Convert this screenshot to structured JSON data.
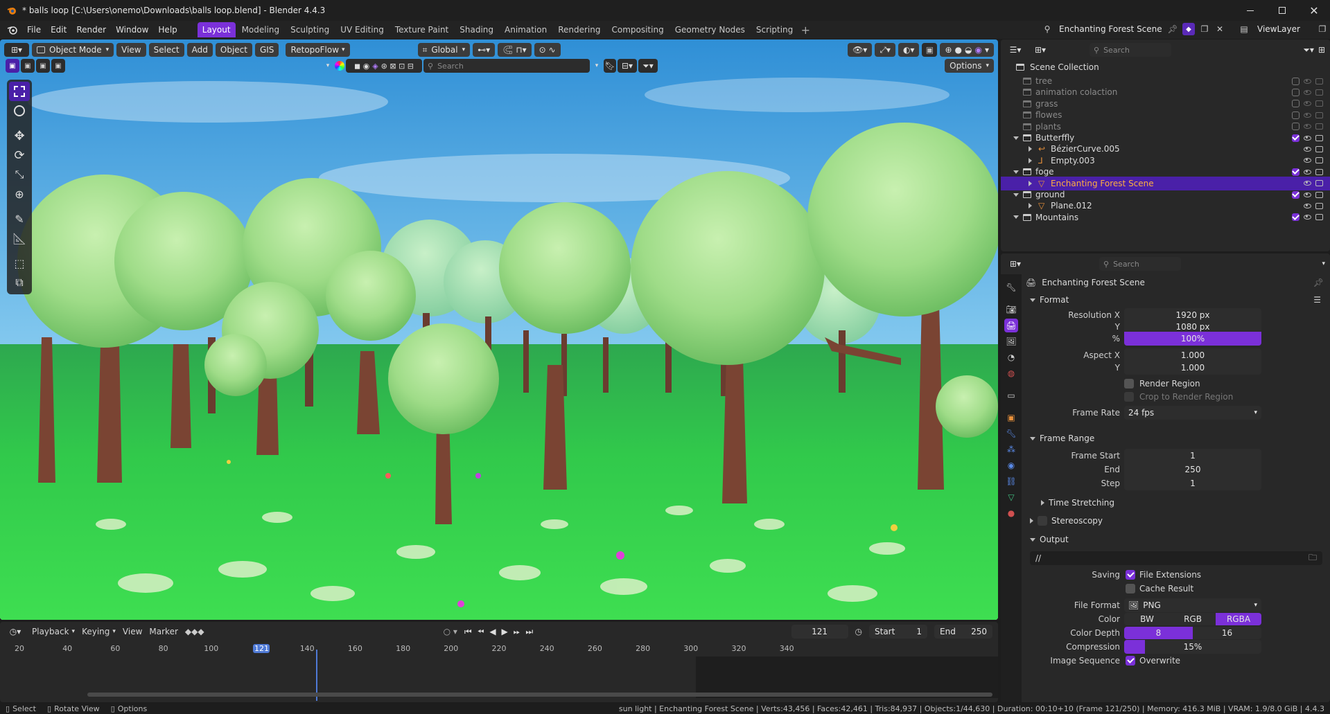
{
  "title_bar": {
    "title": "* balls loop [C:\\Users\\onemo\\Downloads\\balls loop.blend] - Blender 4.4.3"
  },
  "menu": {
    "items": [
      "File",
      "Edit",
      "Render",
      "Window",
      "Help"
    ]
  },
  "workspaces": {
    "tabs": [
      "Layout",
      "Modeling",
      "Sculpting",
      "UV Editing",
      "Texture Paint",
      "Shading",
      "Animation",
      "Rendering",
      "Compositing",
      "Geometry Nodes",
      "Scripting"
    ],
    "active": "Layout"
  },
  "scene_selector": {
    "scene": "Enchanting Forest Scene",
    "view_layer": "ViewLayer"
  },
  "viewport_header": {
    "mode": "Object Mode",
    "menus": [
      "View",
      "Select",
      "Add",
      "Object",
      "GIS"
    ],
    "addon": "RetopoFlow",
    "orientation": "Global",
    "search_placeholder": "Search",
    "options_label": "Options"
  },
  "outliner": {
    "search_placeholder": "Search",
    "root": "Scene Collection",
    "rows": [
      {
        "name": "tree",
        "indent": 0,
        "type": "collection",
        "dim": true
      },
      {
        "name": "animation colaction",
        "indent": 0,
        "type": "collection",
        "dim": true
      },
      {
        "name": "grass",
        "indent": 0,
        "type": "collection",
        "dim": true
      },
      {
        "name": "flowes",
        "indent": 0,
        "type": "collection",
        "dim": true
      },
      {
        "name": "plants",
        "indent": 0,
        "type": "collection",
        "dim": true
      },
      {
        "name": "Butterffly",
        "indent": 0,
        "type": "collection",
        "expanded": true
      },
      {
        "name": "BézierCurve.005",
        "indent": 1,
        "type": "curve"
      },
      {
        "name": "Empty.003",
        "indent": 1,
        "type": "empty"
      },
      {
        "name": "foge",
        "indent": 0,
        "type": "collection",
        "expanded": true
      },
      {
        "name": "Enchanting Forest Scene",
        "indent": 1,
        "type": "mesh",
        "selected": true
      },
      {
        "name": "ground",
        "indent": 0,
        "type": "collection",
        "expanded": true
      },
      {
        "name": "Plane.012",
        "indent": 1,
        "type": "mesh"
      },
      {
        "name": "Mountains",
        "indent": 0,
        "type": "collection",
        "expanded": true
      }
    ]
  },
  "properties": {
    "search_placeholder": "Search",
    "context_name": "Enchanting Forest Scene",
    "format": {
      "header": "Format",
      "resolution_x_label": "Resolution X",
      "resolution_x": "1920 px",
      "resolution_y_label": "Y",
      "resolution_y": "1080 px",
      "percent_label": "%",
      "percent": "100%",
      "percent_value": 1.0,
      "aspect_x_label": "Aspect X",
      "aspect_x": "1.000",
      "aspect_y_label": "Y",
      "aspect_y": "1.000",
      "render_region": "Render Region",
      "crop_region": "Crop to Render Region",
      "frame_rate_label": "Frame Rate",
      "frame_rate": "24 fps"
    },
    "frame_range": {
      "header": "Frame Range",
      "start_label": "Frame Start",
      "start": "1",
      "end_label": "End",
      "end": "250",
      "step_label": "Step",
      "step": "1"
    },
    "time_stretching": "Time Stretching",
    "stereoscopy": "Stereoscopy",
    "output": {
      "header": "Output",
      "path": "//",
      "saving_label": "Saving",
      "file_extensions": "File Extensions",
      "cache_result": "Cache Result",
      "file_format_label": "File Format",
      "file_format": "PNG",
      "color_label": "Color",
      "color_options": [
        "BW",
        "RGB",
        "RGBA"
      ],
      "color_selected": "RGBA",
      "depth_label": "Color Depth",
      "depth_options": [
        "8",
        "16"
      ],
      "depth_selected": "8",
      "compression_label": "Compression",
      "compression": "15%",
      "compression_value": 0.15,
      "image_sequence_label": "Image Sequence",
      "overwrite": "Overwrite"
    }
  },
  "timeline": {
    "menus": [
      "Playback",
      "Keying",
      "View",
      "Marker"
    ],
    "current_frame": "121",
    "start_label": "Start",
    "start": "1",
    "end_label": "End",
    "end": "250",
    "ticks": [
      "20",
      "40",
      "60",
      "80",
      "100",
      "121",
      "140",
      "160",
      "180",
      "200",
      "220",
      "240",
      "260",
      "280",
      "300",
      "320",
      "340"
    ]
  },
  "status_bar": {
    "hints": [
      "Select",
      "Rotate View",
      "Options"
    ],
    "stats": "sun light | Enchanting Forest Scene | Verts:43,456 | Faces:42,461 | Tris:84,937 | Objects:1/44,630 | Duration: 00:10+10 (Frame 121/250) | Memory: 416.3 MiB | VRAM: 1.9/8.0 GiB | 4.4.3"
  },
  "colors": {
    "accent": "#7b30d9",
    "selected_row": "#4a20a8",
    "outliner_sel_text": "#ffae40"
  }
}
